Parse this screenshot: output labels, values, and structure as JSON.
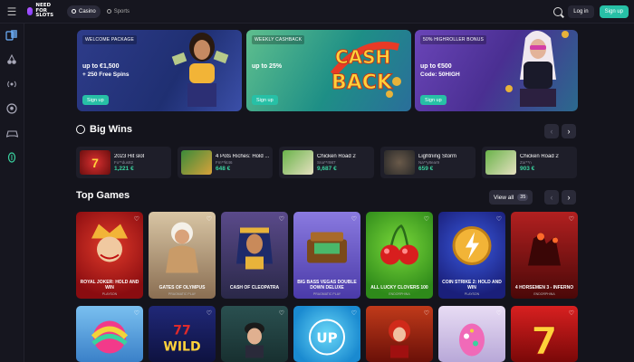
{
  "header": {
    "logo_text": "NEED FOR SLOTS",
    "tabs": [
      {
        "label": "Casino",
        "active": true
      },
      {
        "label": "Sports",
        "active": false
      }
    ],
    "login_label": "Log in",
    "signup_label": "Sign up",
    "accent": "#27c0a6"
  },
  "sidebar": {
    "items": [
      {
        "icon": "casino-icon",
        "active": true
      },
      {
        "icon": "cherries-icon",
        "active": false
      },
      {
        "icon": "live-icon",
        "active": false
      },
      {
        "icon": "soccer-icon",
        "active": false
      },
      {
        "icon": "gamepad-icon",
        "active": false
      },
      {
        "icon": "coin-icon",
        "active": true
      }
    ]
  },
  "banners": [
    {
      "tag": "WELCOME PACKAGE",
      "title": "up to €1,500",
      "subtitle": "+ 250 Free Spins",
      "button": "Sign up",
      "color": "#2e3c8a"
    },
    {
      "tag": "WEEKLY CASHBACK",
      "title": "up to 25%",
      "subtitle": "",
      "button": "Sign up",
      "color": "#1e8f86",
      "art_text_1": "CASH",
      "art_text_2": "BACK"
    },
    {
      "tag": "50% HIGHROLLER BONUS",
      "title": "up to €500",
      "subtitle": "Code: 50HIGH",
      "button": "Sign up",
      "color": "#5a3aa8"
    }
  ],
  "big_wins": {
    "title": "Big Wins",
    "items": [
      {
        "game": "2023 Hit slot",
        "user": "Fo**dus82",
        "amount": "1,221 €"
      },
      {
        "game": "4 Pots Riches: Hold ...",
        "user": "Fm**kt46",
        "amount": "648 €"
      },
      {
        "game": "Chicken Road 2",
        "user": "Sna**r987",
        "amount": "9,687 €"
      },
      {
        "game": "Lightning Storm",
        "user": "Na**y8ear9",
        "amount": "659 €"
      },
      {
        "game": "Chicken Road 2",
        "user": "Zor**n",
        "amount": "903 €"
      }
    ]
  },
  "top_games": {
    "title": "Top Games",
    "view_all": "View all",
    "count": "35",
    "row1": [
      {
        "name": "ROYAL JOKER: HOLD AND WIN",
        "provider": "PLAYSON",
        "color": "#b8141c"
      },
      {
        "name": "GATES OF OLYMPUS",
        "provider": "PRAGMATIC PLAY",
        "color": "#c7a57a"
      },
      {
        "name": "CASH OF CLEOPATRA",
        "provider": "",
        "color": "#3b3564"
      },
      {
        "name": "BIG BASS VEGAS DOUBLE DOWN DELUXE",
        "provider": "PRAGMATIC PLAY",
        "color": "#6e5bd0"
      },
      {
        "name": "ALL LUCKY CLOVERS 100",
        "provider": "ENDORPHINA",
        "color": "#52b42a"
      },
      {
        "name": "COIN STRIKE 2: HOLD AND WIN",
        "provider": "PLAYSON",
        "color": "#2a3cb8"
      },
      {
        "name": "4 HORSEMEN 3 - INFERNO",
        "provider": "ENDORPHINA",
        "color": "#8e1616"
      }
    ],
    "row2": [
      {
        "color": "#52a6e8"
      },
      {
        "color": "#1a1f6a"
      },
      {
        "color": "#2e6a6a"
      },
      {
        "color": "#2db8e6"
      },
      {
        "color": "#9a2414"
      },
      {
        "color": "#d7c8e8"
      },
      {
        "color": "#c01818"
      }
    ]
  }
}
